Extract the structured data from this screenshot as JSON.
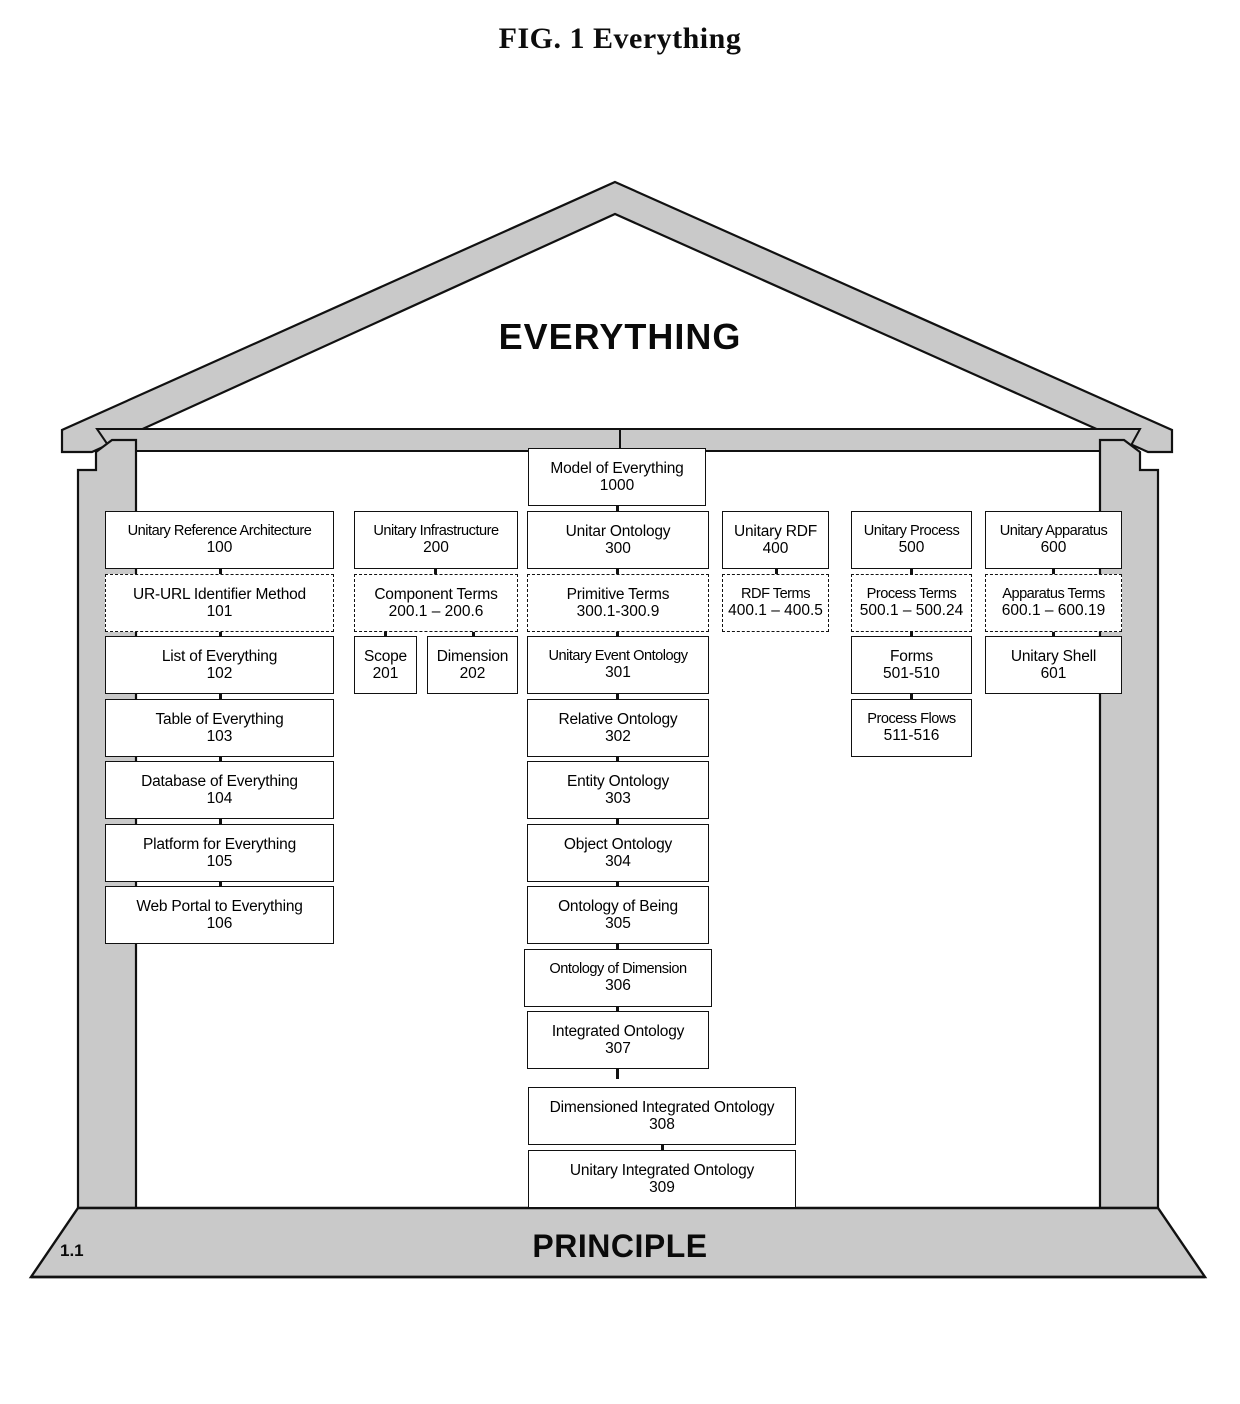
{
  "figure": {
    "title": "FIG. 1 Everything",
    "reference_number": "1.1",
    "roof_label": "EVERYTHING",
    "base_label": "PRINCIPLE"
  },
  "colors": {
    "structure_fill": "#c9c9c9",
    "structure_stroke": "#111111",
    "box_stroke": "#111111",
    "background": "#ffffff",
    "text": "#000000"
  },
  "columns": [
    {
      "id": "unitary-reference-architecture",
      "boxes": [
        {
          "label": "Unitary Reference Architecture",
          "number": "100",
          "style": "solid"
        },
        {
          "label": "UR-URL Identifier Method",
          "number": "101",
          "style": "dashed"
        },
        {
          "label": "List of Everything",
          "number": "102",
          "style": "solid"
        },
        {
          "label": "Table of Everything",
          "number": "103",
          "style": "solid"
        },
        {
          "label": "Database of Everything",
          "number": "104",
          "style": "solid"
        },
        {
          "label": "Platform for Everything",
          "number": "105",
          "style": "solid"
        },
        {
          "label": "Web Portal to Everything",
          "number": "106",
          "style": "solid"
        }
      ]
    },
    {
      "id": "unitary-infrastructure",
      "boxes": [
        {
          "label": "Unitary Infrastructure",
          "number": "200",
          "style": "solid"
        },
        {
          "label": "Component Terms",
          "number": "200.1 – 200.6",
          "style": "dashed"
        },
        {
          "label": "Scope",
          "number": "201",
          "style": "solid"
        },
        {
          "label": "Dimension",
          "number": "202",
          "style": "solid"
        }
      ]
    },
    {
      "id": "unitar-ontology",
      "boxes": [
        {
          "label": "Model of Everything",
          "number": "1000",
          "style": "solid"
        },
        {
          "label": "Unitar Ontology",
          "number": "300",
          "style": "solid"
        },
        {
          "label": "Primitive Terms",
          "number": "300.1-300.9",
          "style": "dashed"
        },
        {
          "label": "Unitary Event Ontology",
          "number": "301",
          "style": "solid"
        },
        {
          "label": "Relative Ontology",
          "number": "302",
          "style": "solid"
        },
        {
          "label": "Entity Ontology",
          "number": "303",
          "style": "solid"
        },
        {
          "label": "Object Ontology",
          "number": "304",
          "style": "solid"
        },
        {
          "label": "Ontology of Being",
          "number": "305",
          "style": "solid"
        },
        {
          "label": "Ontology of Dimension",
          "number": "306",
          "style": "solid"
        },
        {
          "label": "Integrated Ontology",
          "number": "307",
          "style": "solid"
        },
        {
          "label": "Dimensioned Integrated Ontology",
          "number": "308",
          "style": "solid"
        },
        {
          "label": "Unitary Integrated Ontology",
          "number": "309",
          "style": "solid"
        }
      ]
    },
    {
      "id": "unitary-rdf",
      "boxes": [
        {
          "label": "Unitary RDF",
          "number": "400",
          "style": "solid"
        },
        {
          "label": "RDF Terms",
          "number": "400.1 – 400.5",
          "style": "dashed"
        }
      ]
    },
    {
      "id": "unitary-process",
      "boxes": [
        {
          "label": "Unitary Process",
          "number": "500",
          "style": "solid"
        },
        {
          "label": "Process Terms",
          "number": "500.1 – 500.24",
          "style": "dashed"
        },
        {
          "label": "Forms",
          "number": "501-510",
          "style": "solid"
        },
        {
          "label": "Process Flows",
          "number": "511-516",
          "style": "solid"
        }
      ]
    },
    {
      "id": "unitary-apparatus",
      "boxes": [
        {
          "label": "Unitary Apparatus",
          "number": "600",
          "style": "solid"
        },
        {
          "label": "Apparatus Terms",
          "number": "600.1 – 600.19",
          "style": "dashed"
        },
        {
          "label": "Unitary Shell",
          "number": "601",
          "style": "solid"
        }
      ]
    }
  ]
}
